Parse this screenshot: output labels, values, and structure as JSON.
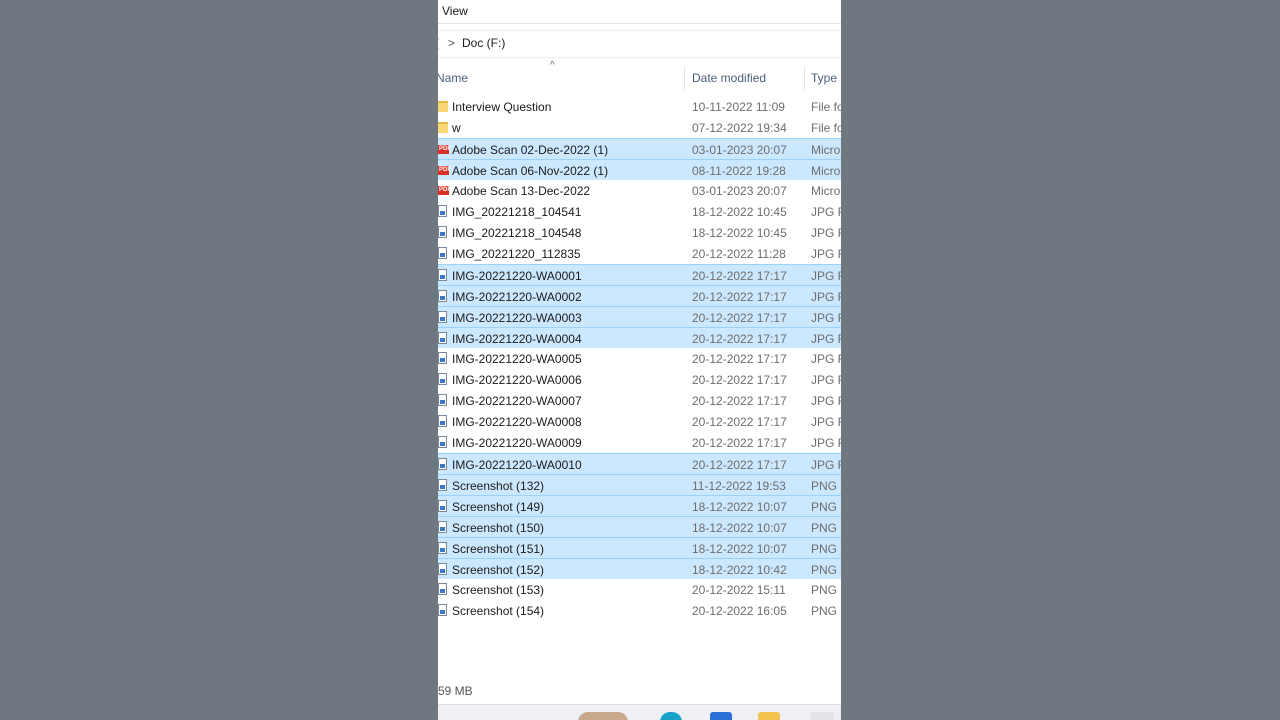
{
  "menu": {
    "view_label": "View"
  },
  "address": {
    "left_fragment": "(",
    "chevron": ">",
    "path": "Doc (F:)"
  },
  "header": {
    "sort_indicator": "^",
    "name": "Name",
    "date_modified": "Date modified",
    "type": "Type"
  },
  "files": [
    {
      "name": "Interview Question",
      "date": "10-11-2022 11:09",
      "type": "File fo",
      "icon": "folder-icon",
      "selected": false
    },
    {
      "name": "w",
      "date": "07-12-2022 19:34",
      "type": "File fo",
      "icon": "folder-icon",
      "selected": false
    },
    {
      "name": "Adobe Scan 02-Dec-2022 (1)",
      "date": "03-01-2023 20:07",
      "type": "Micro",
      "icon": "pdf-icon",
      "selected": true
    },
    {
      "name": "Adobe Scan 06-Nov-2022 (1)",
      "date": "08-11-2022 19:28",
      "type": "Micro",
      "icon": "pdf-icon",
      "selected": true
    },
    {
      "name": "Adobe Scan 13-Dec-2022",
      "date": "03-01-2023 20:07",
      "type": "Micro",
      "icon": "pdf-icon",
      "selected": false
    },
    {
      "name": "IMG_20221218_104541",
      "date": "18-12-2022 10:45",
      "type": "JPG Fi",
      "icon": "image-icon",
      "selected": false
    },
    {
      "name": "IMG_20221218_104548",
      "date": "18-12-2022 10:45",
      "type": "JPG Fi",
      "icon": "image-icon",
      "selected": false
    },
    {
      "name": "IMG_20221220_112835",
      "date": "20-12-2022 11:28",
      "type": "JPG Fi",
      "icon": "image-icon",
      "selected": false
    },
    {
      "name": "IMG-20221220-WA0001",
      "date": "20-12-2022 17:17",
      "type": "JPG Fi",
      "icon": "image-icon",
      "selected": true
    },
    {
      "name": "IMG-20221220-WA0002",
      "date": "20-12-2022 17:17",
      "type": "JPG Fi",
      "icon": "image-icon",
      "selected": true
    },
    {
      "name": "IMG-20221220-WA0003",
      "date": "20-12-2022 17:17",
      "type": "JPG Fi",
      "icon": "image-icon",
      "selected": true
    },
    {
      "name": "IMG-20221220-WA0004",
      "date": "20-12-2022 17:17",
      "type": "JPG Fi",
      "icon": "image-icon",
      "selected": true
    },
    {
      "name": "IMG-20221220-WA0005",
      "date": "20-12-2022 17:17",
      "type": "JPG Fi",
      "icon": "image-icon",
      "selected": false
    },
    {
      "name": "IMG-20221220-WA0006",
      "date": "20-12-2022 17:17",
      "type": "JPG Fi",
      "icon": "image-icon",
      "selected": false
    },
    {
      "name": "IMG-20221220-WA0007",
      "date": "20-12-2022 17:17",
      "type": "JPG Fi",
      "icon": "image-icon",
      "selected": false
    },
    {
      "name": "IMG-20221220-WA0008",
      "date": "20-12-2022 17:17",
      "type": "JPG Fi",
      "icon": "image-icon",
      "selected": false
    },
    {
      "name": "IMG-20221220-WA0009",
      "date": "20-12-2022 17:17",
      "type": "JPG Fi",
      "icon": "image-icon",
      "selected": false
    },
    {
      "name": "IMG-20221220-WA0010",
      "date": "20-12-2022 17:17",
      "type": "JPG Fi",
      "icon": "image-icon",
      "selected": true
    },
    {
      "name": "Screenshot (132)",
      "date": "11-12-2022 19:53",
      "type": "PNG F",
      "icon": "image-icon",
      "selected": true
    },
    {
      "name": "Screenshot (149)",
      "date": "18-12-2022 10:07",
      "type": "PNG F",
      "icon": "image-icon",
      "selected": true
    },
    {
      "name": "Screenshot (150)",
      "date": "18-12-2022 10:07",
      "type": "PNG F",
      "icon": "image-icon",
      "selected": true
    },
    {
      "name": "Screenshot (151)",
      "date": "18-12-2022 10:07",
      "type": "PNG F",
      "icon": "image-icon",
      "selected": true
    },
    {
      "name": "Screenshot (152)",
      "date": "18-12-2022 10:42",
      "type": "PNG F",
      "icon": "image-icon",
      "selected": true
    },
    {
      "name": "Screenshot (153)",
      "date": "20-12-2022 15:11",
      "type": "PNG F",
      "icon": "image-icon",
      "selected": false
    },
    {
      "name": "Screenshot (154)",
      "date": "20-12-2022 16:05",
      "type": "PNG F",
      "icon": "image-icon",
      "selected": false
    }
  ],
  "status": {
    "size_text": "59 MB"
  },
  "colors": {
    "selection": "#cce8ff",
    "selection_border": "#99d1ff",
    "background": "#6f7881"
  }
}
